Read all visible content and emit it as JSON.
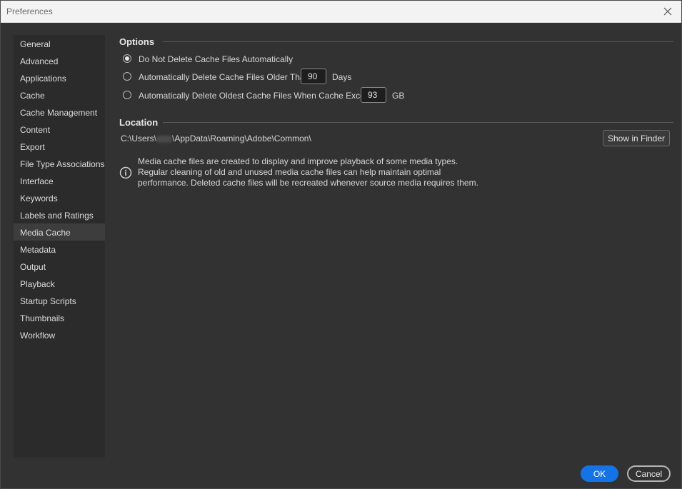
{
  "window": {
    "title": "Preferences"
  },
  "sidebar": {
    "items": [
      {
        "label": "General"
      },
      {
        "label": "Advanced"
      },
      {
        "label": "Applications"
      },
      {
        "label": "Cache"
      },
      {
        "label": "Cache Management"
      },
      {
        "label": "Content"
      },
      {
        "label": "Export"
      },
      {
        "label": "File Type Associations"
      },
      {
        "label": "Interface"
      },
      {
        "label": "Keywords"
      },
      {
        "label": "Labels and Ratings"
      },
      {
        "label": "Media Cache"
      },
      {
        "label": "Metadata"
      },
      {
        "label": "Output"
      },
      {
        "label": "Playback"
      },
      {
        "label": "Startup Scripts"
      },
      {
        "label": "Thumbnails"
      },
      {
        "label": "Workflow"
      }
    ],
    "selected": "Media Cache"
  },
  "options": {
    "title": "Options",
    "radio1_label": "Do Not Delete Cache Files Automatically",
    "radio2_label": "Automatically Delete Cache Files Older Than",
    "radio2_value": "90",
    "radio2_unit": "Days",
    "radio3_label": "Automatically Delete Oldest Cache Files When Cache Exceeds",
    "radio3_value": "93",
    "radio3_unit": "GB",
    "selected_option": 1
  },
  "location": {
    "title": "Location",
    "path_prefix": "C:\\Users\\",
    "path_suffix": "\\AppData\\Roaming\\Adobe\\Common\\",
    "show_in_finder_label": "Show in Finder",
    "info_text": "Media cache files are created to display and improve playback of some media types. Regular cleaning of old and unused media cache files can help maintain optimal performance. Deleted cache files will be recreated whenever source media requires them."
  },
  "footer": {
    "ok_label": "OK",
    "cancel_label": "Cancel"
  },
  "colors": {
    "background": "#323232",
    "sidebar": "#2b2b2b",
    "accent": "#1473e6"
  }
}
